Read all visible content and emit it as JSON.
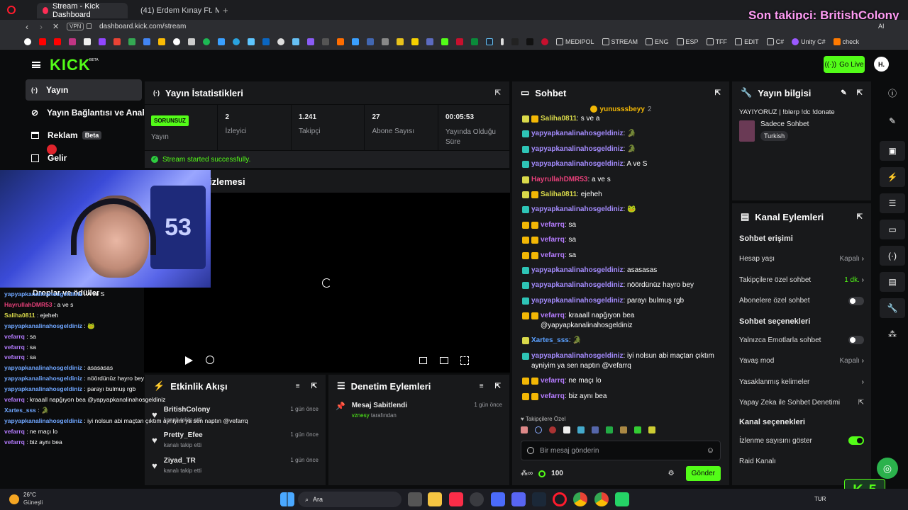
{
  "browser": {
    "tabs": [
      "Stream - Kick Dashboard",
      "(41) Erdem Kınay Ft. M..."
    ],
    "url": "dashboard.kick.com/stream",
    "vpn": "VPN",
    "bookmarks": [
      "MEDIPOL",
      "STREAM",
      "ENG",
      "ESP",
      "TFF",
      "EDIT",
      "C#",
      "Unity C#",
      "check"
    ],
    "ai": "AI"
  },
  "overlay_top": "Son takipçi: BritishColony",
  "app": {
    "logo": "KICK",
    "logo_sup": "BETA",
    "go_live": "Go Live",
    "avatar": "H."
  },
  "sidebar": [
    {
      "label": "Yayın"
    },
    {
      "label": "Yayın Bağlantısı ve Anahtar"
    },
    {
      "label": "Reklam",
      "badge": "Beta"
    },
    {
      "label": "Gelir"
    },
    {
      "label": "Droplar ve ödüller"
    }
  ],
  "stats": {
    "title": "Yayın İstatistikleri",
    "cells": [
      {
        "value": "SORUNSUZ",
        "label": "Yayın"
      },
      {
        "value": "2",
        "label": "İzleyici"
      },
      {
        "value": "1.241",
        "label": "Takipçi"
      },
      {
        "value": "27",
        "label": "Abone Sayısı"
      },
      {
        "value": "00:05:53",
        "label": "Yayında Olduğu Süre"
      }
    ],
    "status": "Stream started successfully."
  },
  "preview": {
    "title": "izlemesi"
  },
  "activity": {
    "title": "Etkinlik Akışı",
    "items": [
      {
        "name": "BritishColony",
        "sub": "kanalı takip etti",
        "time": "1 gün önce"
      },
      {
        "name": "Pretty_Efee",
        "sub": "kanalı takip etti",
        "time": "1 gün önce"
      },
      {
        "name": "Ziyad_TR",
        "sub": "kanalı takip etti",
        "time": "1 gün önce"
      }
    ]
  },
  "moderation": {
    "title": "Denetim Eylemleri",
    "items": [
      {
        "name": "Mesaj Sabitlendi",
        "by": "vznesy",
        "suffix": "tarafından",
        "time": "1 gün önce"
      }
    ]
  },
  "chat": {
    "title": "Sohbet",
    "pinned_user": "yunusssbeyy",
    "pinned_count": "2",
    "messages": [
      {
        "user": "Saliha0811",
        "color": "#d9d94a",
        "text": "s ve a"
      },
      {
        "user": "yapyapkanalinahosgeldiniz",
        "color": "#a58cff",
        "text": "🐊"
      },
      {
        "user": "yapyapkanalinahosgeldiniz",
        "color": "#a58cff",
        "text": "🐊"
      },
      {
        "user": "yapyapkanalinahosgeldiniz",
        "color": "#a58cff",
        "text": "A ve S"
      },
      {
        "user": "HayrullahDMR53",
        "color": "#e8407a",
        "text": "a ve s"
      },
      {
        "user": "Saliha0811",
        "color": "#d9d94a",
        "text": "ejeheh"
      },
      {
        "user": "yapyapkanalinahosgeldiniz",
        "color": "#a58cff",
        "text": "🐸"
      },
      {
        "user": "vefarrq",
        "color": "#b57cff",
        "text": "sa"
      },
      {
        "user": "vefarrq",
        "color": "#b57cff",
        "text": "sa"
      },
      {
        "user": "vefarrq",
        "color": "#b57cff",
        "text": "sa"
      },
      {
        "user": "yapyapkanalinahosgeldiniz",
        "color": "#a58cff",
        "text": "asasasas"
      },
      {
        "user": "yapyapkanalinahosgeldiniz",
        "color": "#a58cff",
        "text": "nöördünüz hayro bey"
      },
      {
        "user": "yapyapkanalinahosgeldiniz",
        "color": "#a58cff",
        "text": "parayı bulmuş rgb"
      },
      {
        "user": "vefarrq",
        "color": "#b57cff",
        "text": "kraaall napğıyon bea @yapyapkanalinahosgeldiniz"
      },
      {
        "user": "Xartes_sss",
        "color": "#5aa0ff",
        "text": "🐊"
      },
      {
        "user": "yapyapkanalinahosgeldiniz",
        "color": "#a58cff",
        "text": "iyi nolsun abi maçtan çıktım ayniyim ya sen naptın @vefarrq"
      },
      {
        "user": "vefarrq",
        "color": "#b57cff",
        "text": "ne maçı lo"
      },
      {
        "user": "vefarrq",
        "color": "#b57cff",
        "text": "biz aynı bea"
      }
    ],
    "followers_only": "Takipçilere Özel",
    "placeholder": "Bir mesaj gönderin",
    "points": "100",
    "send": "Gönder"
  },
  "info": {
    "title": "Yayın bilgisi",
    "stream_title": "YAYIYORUZ | !blerp !dc !donate",
    "category": "Sadece Sohbet",
    "tag": "Turkish"
  },
  "channel": {
    "title": "Kanal Eylemleri",
    "chat_access": "Sohbet erişimi",
    "account_age": "Hesap yaşı",
    "account_age_val": "Kapalı",
    "followers_chat": "Takipçilere özel sohbet",
    "followers_val": "1 dk.",
    "subs_chat": "Abonelere özel sohbet",
    "chat_options": "Sohbet seçenekleri",
    "emote_only": "Yalnızca Emotlarla sohbet",
    "slow_mode": "Yavaş mod",
    "slow_val": "Kapalı",
    "banned_words": "Yasaklanmış kelimeler",
    "ai_mod": "Yapay Zeka ile Sohbet Denetimi",
    "channel_options": "Kanal seçenekleri",
    "show_viewers": "İzlenme sayısını göster",
    "raid": "Raid Kanalı"
  },
  "overlay_chat": [
    {
      "user": "yapyapkanalinahosgeldiniz",
      "text": "A ve S"
    },
    {
      "user": "HayrullahDMR53",
      "text": "a ve s"
    },
    {
      "user": "Saliha0811",
      "text": "ejeheh"
    },
    {
      "user": "yapyapkanalinahosgeldiniz",
      "text": "🐸"
    },
    {
      "user": "vefarrq",
      "text": "sa"
    },
    {
      "user": "vefarrq",
      "text": "sa"
    },
    {
      "user": "vefarrq",
      "text": "sa"
    },
    {
      "user": "yapyapkanalinahosgeldiniz",
      "text": "asasasas"
    },
    {
      "user": "yapyapkanalinahosgeldiniz",
      "text": "nöördünüz hayro bey"
    },
    {
      "user": "yapyapkanalinahosgeldiniz",
      "text": "parayı bulmuş rgb"
    },
    {
      "user": "vefarrq",
      "text": "kraaall napğıyon bea @yapyapkanalinahosgeldiniz"
    },
    {
      "user": "Xartes_sss",
      "text": "🐊"
    },
    {
      "user": "yapyapkanalinahosgeldiniz",
      "text": "iyi nolsun abi maçtan çıktım ayniyim ya sen naptın @vefarrq"
    },
    {
      "user": "vefarrq",
      "text": "ne maçı lo"
    },
    {
      "user": "vefarrq",
      "text": "biz aynı bea"
    }
  ],
  "overlay_badge": "5",
  "taskbar": {
    "weather_temp": "26°C",
    "weather_desc": "Güneşli",
    "search": "Ara",
    "lang": "TUR"
  }
}
